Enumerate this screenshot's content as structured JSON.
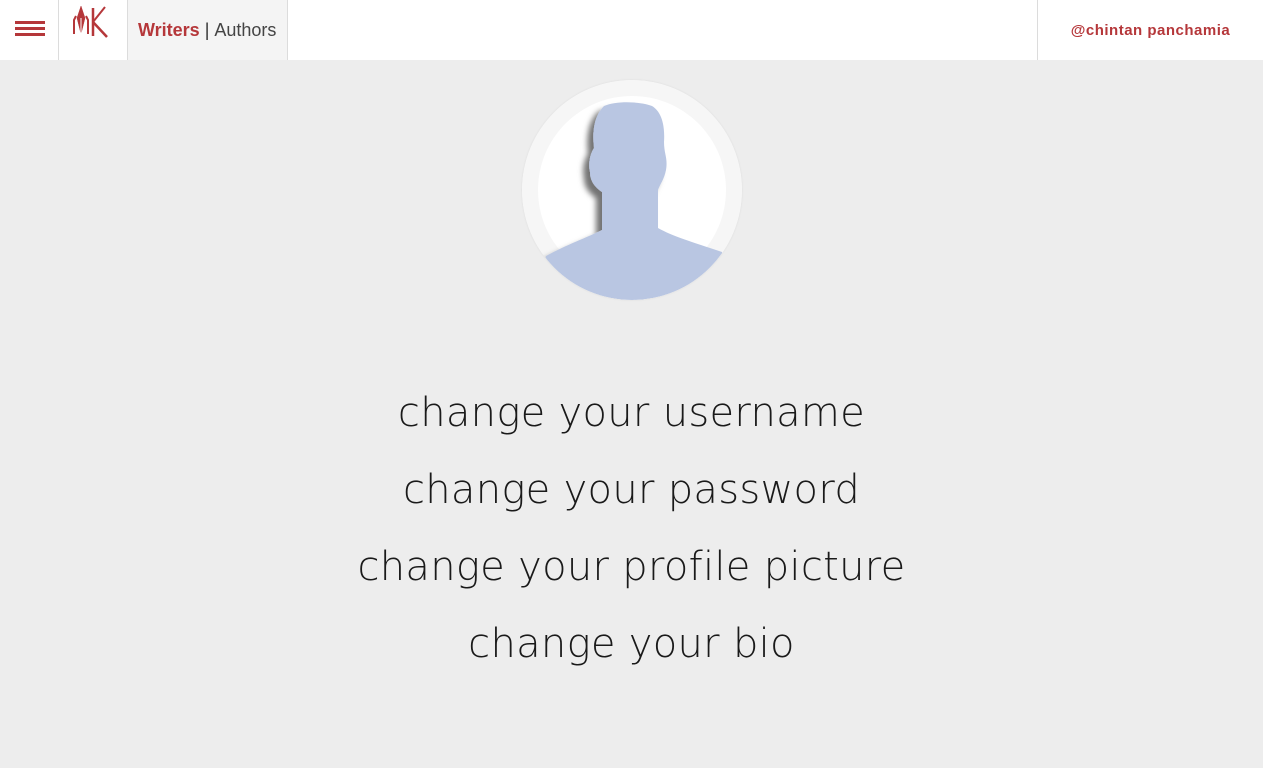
{
  "header": {
    "menu_icon": "hamburger-menu-icon",
    "logo_icon": "pen-nib-logo-icon",
    "tabs": {
      "writers": "Writers",
      "separator": "|",
      "authors": "Authors"
    },
    "user_handle": "@chintan panchamia"
  },
  "profile": {
    "avatar_icon": "default-user-silhouette-icon"
  },
  "settings": {
    "items": [
      "change your username",
      "change your password",
      "change your profile picture",
      "change your bio"
    ]
  },
  "colors": {
    "accent": "#b5373a",
    "background": "#ededed",
    "avatar_silhouette": "#b9c6e2"
  }
}
